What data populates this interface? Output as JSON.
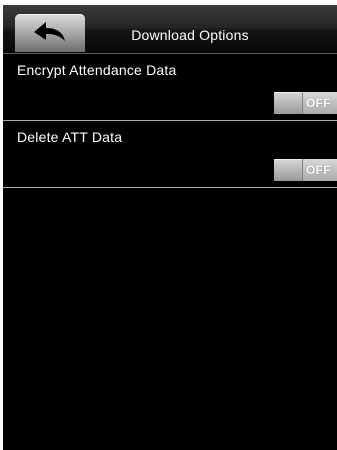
{
  "header": {
    "back_icon": "back-arrow-icon",
    "title": "Download Options"
  },
  "settings": [
    {
      "label": "Encrypt Attendance Data",
      "toggle_label": "OFF",
      "state": "off"
    },
    {
      "label": "Delete ATT Data",
      "toggle_label": "OFF",
      "state": "off"
    }
  ],
  "colors": {
    "background": "#000000",
    "text": "#ffffff",
    "divider": "#a8a8a8",
    "toggle_off": "#b5b5b5"
  }
}
